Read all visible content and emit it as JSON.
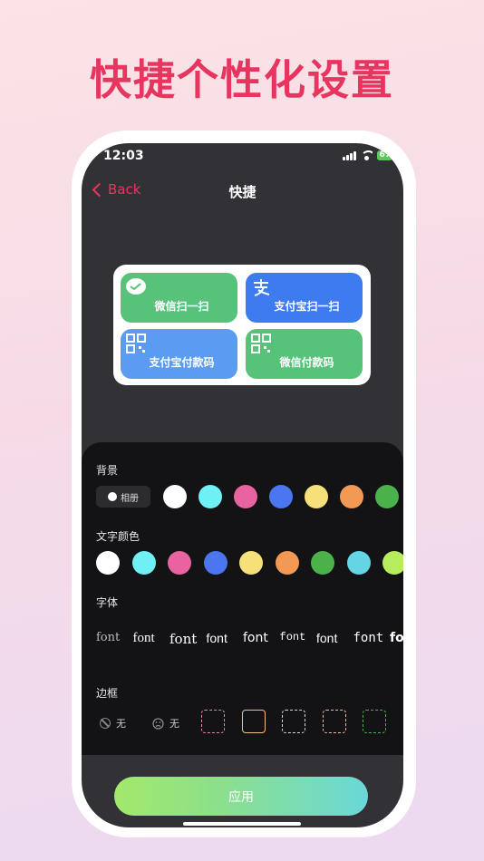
{
  "headline": "快捷个性化设置",
  "status": {
    "time": "12:03",
    "battery": "67"
  },
  "nav": {
    "back": "Back",
    "title": "快捷"
  },
  "widget": {
    "tiles": [
      {
        "label": "微信扫一扫",
        "color": "#56c27a",
        "icon": "wechat-icon"
      },
      {
        "label": "支付宝扫一扫",
        "color": "#3d7bf0",
        "icon": "alipay-icon"
      },
      {
        "label": "支付宝付款码",
        "color": "#5b9cf2",
        "icon": "qr-icon"
      },
      {
        "label": "微信付款码",
        "color": "#56c27a",
        "icon": "qr-icon"
      }
    ]
  },
  "settings": {
    "background": {
      "label": "背景",
      "album": "相册",
      "colors": [
        "#ffffff",
        "#6ef0f5",
        "#e8639f",
        "#4a76ef",
        "#f7e07a",
        "#f29a53",
        "#4bb14a"
      ]
    },
    "text_color": {
      "label": "文字颜色",
      "colors": [
        "#ffffff",
        "#6ef0f5",
        "#e8639f",
        "#4a76ef",
        "#f7e07a",
        "#f29a53",
        "#4bb14a",
        "#63d6e6",
        "#b7ec5d"
      ]
    },
    "font": {
      "label": "字体",
      "samples": [
        "font",
        "font",
        "font",
        "font",
        "font",
        "font",
        "font",
        "font",
        "font"
      ]
    },
    "border": {
      "label": "边框",
      "none1": "无",
      "none2": "无",
      "colors": [
        "#e58aa0",
        "#f2c084",
        "#d9d9d9",
        "#f5b8a8",
        "#4bb14a"
      ]
    }
  },
  "apply": "应用"
}
